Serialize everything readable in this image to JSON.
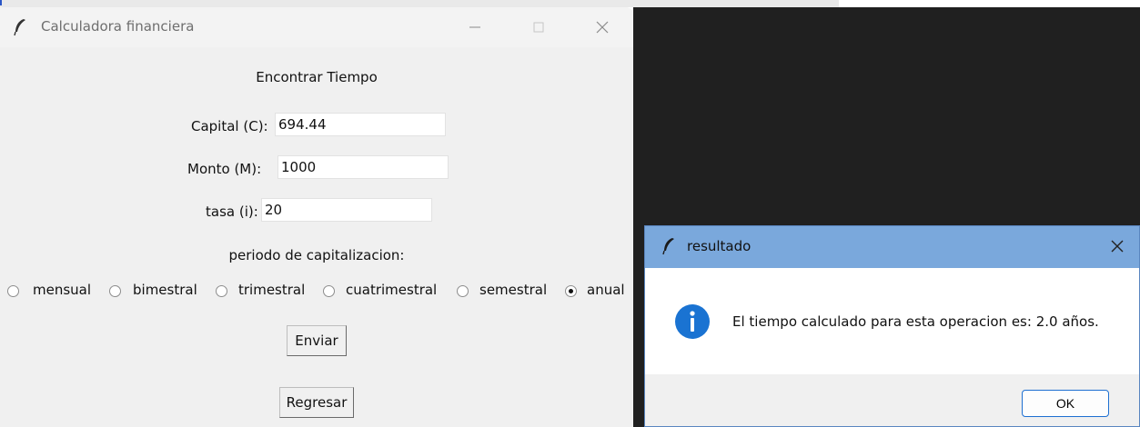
{
  "main_window": {
    "title": "Calculadora financiera",
    "heading": "Encontrar Tiempo",
    "fields": {
      "capital_label": "Capital (C):",
      "capital_value": "694.44",
      "monto_label": "Monto (M):",
      "monto_value": "1000",
      "tasa_label": "tasa (i):",
      "tasa_value": "20"
    },
    "period_label": "periodo de capitalizacion:",
    "periods": [
      "mensual",
      "bimestral",
      "trimestral",
      "cuatrimestral",
      "semestral",
      "anual"
    ],
    "selected_period": "anual",
    "enviar_label": "Enviar",
    "regresar_label": "Regresar"
  },
  "dialog": {
    "title": "resultado",
    "message": "El tiempo calculado para esta operacion es: 2.0 años.",
    "ok_label": "OK"
  },
  "icons": [
    "feather-icon",
    "minimize-icon",
    "maximize-icon",
    "close-icon",
    "info-icon"
  ],
  "colors": {
    "dialog_titlebar": "#7aa8dc",
    "info_icon": "#1a73d2",
    "ok_border": "#1d6fd1",
    "desktop_dark": "#202020"
  }
}
